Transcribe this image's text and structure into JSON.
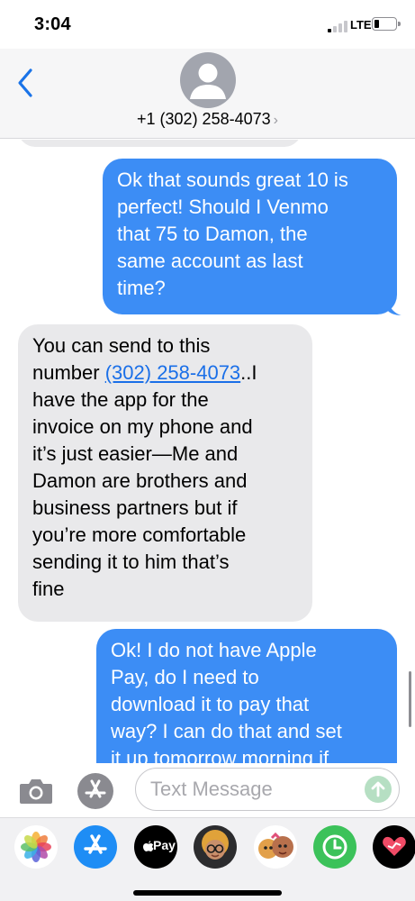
{
  "status_bar": {
    "time": "3:04",
    "network": "LTE"
  },
  "header": {
    "contact": "+1 (302) 258-4073",
    "chevron": "›",
    "back_icon": "chevron-left-icon",
    "avatar_icon": "person-silhouette-icon"
  },
  "messages": [
    {
      "direction": "outgoing",
      "lines": [
        "Ok that sounds great 10 is",
        "perfect! Should I Venmo",
        "that 75 to Damon, the",
        "same account as last",
        "time?"
      ]
    },
    {
      "direction": "incoming",
      "first_line": "You can send to this",
      "number_prefix": "number ",
      "phone_link": "(302) 258-4073",
      "number_suffix": "..I",
      "lines": [
        "have the app for the",
        "invoice on my phone and",
        "it’s just easier—Me and",
        "Damon are brothers and",
        "business partners but if",
        "you’re more comfortable",
        "sending it to him that’s",
        "fine"
      ]
    },
    {
      "direction": "outgoing",
      "lines": [
        "Ok! I do not have Apple",
        "Pay,  do I need to",
        "download it to pay that",
        "way? I can do that and set",
        "it up tomorrow morning if"
      ]
    }
  ],
  "input_bar": {
    "placeholder": "Text Message",
    "value": ""
  },
  "app_drawer": {
    "apps": [
      {
        "name": "photos",
        "icon": "photos-icon"
      },
      {
        "name": "app-store",
        "icon": "app-store-icon"
      },
      {
        "name": "apple-pay",
        "icon": "apple-pay-icon",
        "label": "Pay"
      },
      {
        "name": "memoji",
        "icon": "memoji-icon"
      },
      {
        "name": "memoji-stickers",
        "icon": "memoji-stickers-icon"
      },
      {
        "name": "screen-time",
        "icon": "clock-icon"
      },
      {
        "name": "digital-touch",
        "icon": "heart-icon"
      }
    ]
  },
  "colors": {
    "outgoing_bubble": "#3c8df5",
    "incoming_bubble": "#e9e9eb",
    "link": "#1a6fe8"
  }
}
